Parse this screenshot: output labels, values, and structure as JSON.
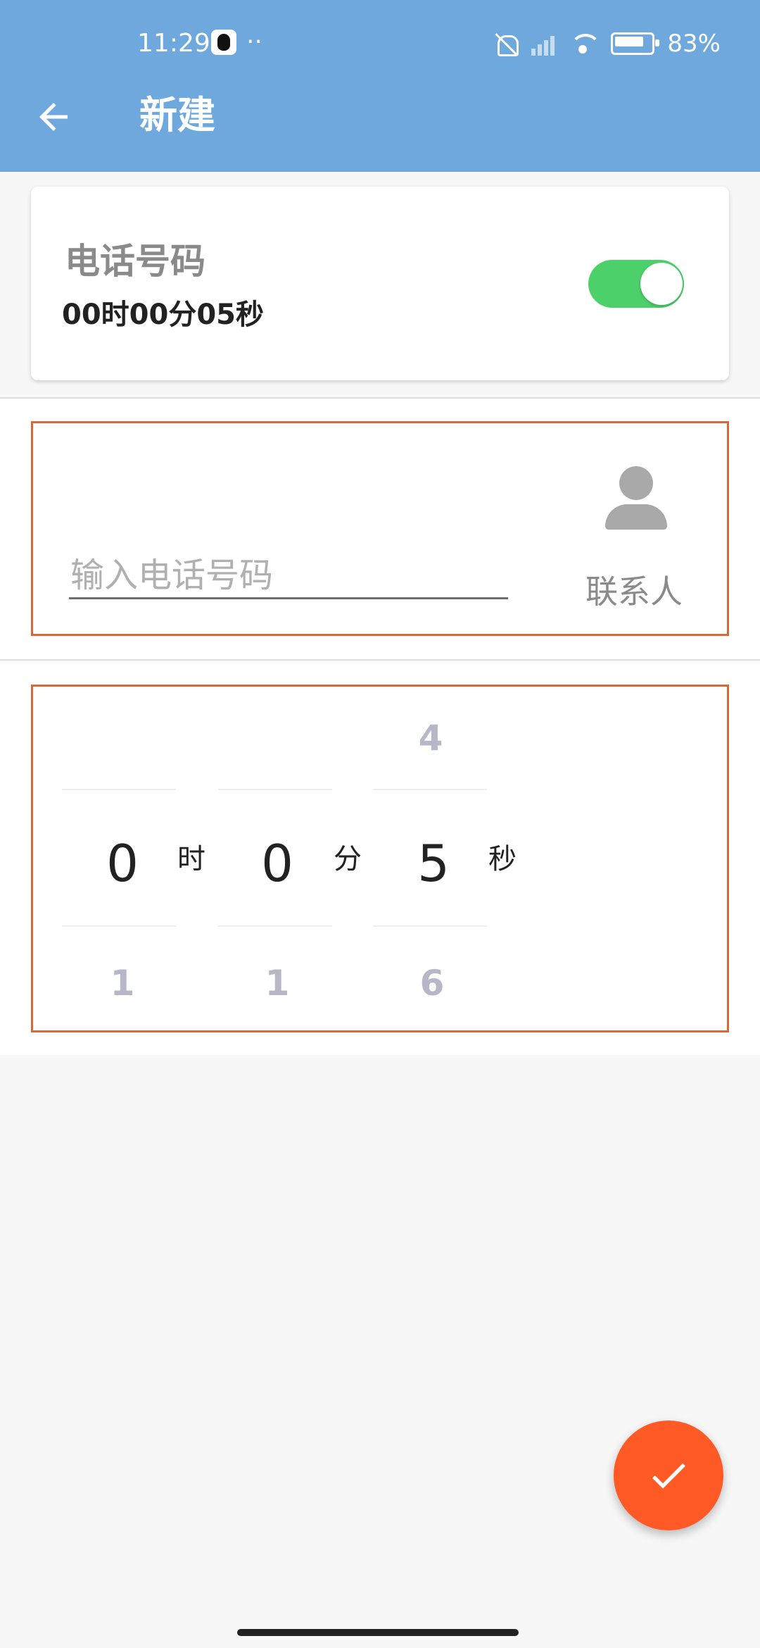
{
  "status_bar": {
    "time": "11:29",
    "dots": "··",
    "battery": "83%"
  },
  "app_bar": {
    "title": "新建",
    "icons": [
      "back-arrow-icon"
    ]
  },
  "card": {
    "title": "电话号码",
    "duration": "00时00分05秒",
    "toggle_on": true
  },
  "phone_input": {
    "placeholder": "输入电话号码",
    "value": ""
  },
  "contact": {
    "label": "联系人",
    "icon": "person-icon"
  },
  "time_picker": {
    "hours": {
      "above": "",
      "selected": "0",
      "below": "1",
      "unit": "时"
    },
    "minutes": {
      "above": "",
      "selected": "0",
      "below": "1",
      "unit": "分"
    },
    "seconds": {
      "above": "4",
      "selected": "5",
      "below": "6",
      "unit": "秒"
    }
  },
  "fab": {
    "icon": "check-icon"
  },
  "colors": {
    "app_bar": "#6fa8dc",
    "toggle": "#4cd16a",
    "outline": "#d56b3a",
    "fab": "#ff5a26"
  }
}
